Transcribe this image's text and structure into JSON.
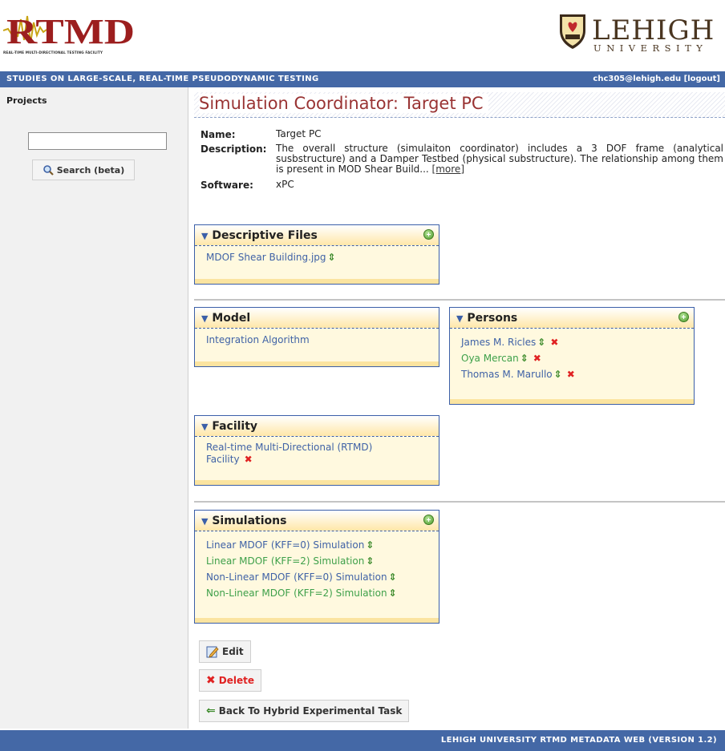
{
  "header": {
    "logo_text": "RTMD",
    "logo_subtitle": "REAL-TIME MULTI-DIRECTIONAL TESTING FACILITY",
    "university_name": "LEHIGH",
    "university_sub": "UNIVERSITY",
    "tagline": "STUDIES ON LARGE-SCALE, REAL-TIME PSEUDODYNAMIC TESTING",
    "user_email": "chc305@lehigh.edu",
    "logout_label": "[logout]"
  },
  "sidebar": {
    "title": "Projects",
    "search_value": "",
    "search_button": "Search (beta)"
  },
  "main": {
    "title": "Simulation Coordinator: Target PC",
    "name_label": "Name:",
    "name_value": "Target PC",
    "description_label": "Description:",
    "description_value": "The overall structure (simulaiton coordinator) includes a 3 DOF frame (analytical susbstructure) and a Damper Testbed (physical substructure). The relationship among them is present in MOD Shear Build...",
    "more_label": "[more]",
    "software_label": "Software:",
    "software_value": "xPC"
  },
  "panels": {
    "descriptive_files": {
      "title": "Descriptive Files",
      "items": [
        "MDOF Shear Building.jpg"
      ]
    },
    "model": {
      "title": "Model",
      "items": [
        "Integration Algorithm"
      ]
    },
    "persons": {
      "title": "Persons",
      "items": [
        "James M. Ricles",
        "Oya Mercan",
        "Thomas M. Marullo"
      ]
    },
    "facility": {
      "title": "Facility",
      "items": [
        "Real-time Multi-Directional (RTMD) Facility"
      ]
    },
    "simulations": {
      "title": "Simulations",
      "items": [
        "Linear MDOF (KFF=0) Simulation",
        "Linear MDOF (KFF=2) Simulation",
        "Non-Linear MDOF (KFF=0) Simulation",
        "Non-Linear MDOF (KFF=2) Simulation"
      ]
    }
  },
  "buttons": {
    "edit": "Edit",
    "delete": "Delete",
    "back": "Back To Hybrid Experimental Task"
  },
  "footer": {
    "text": "LEHIGH UNIVERSITY RTMD METADATA WEB (VERSION 1.2)"
  },
  "colors": {
    "bar_blue": "#4468a6",
    "title_red": "#993333",
    "link_blue": "#3f62a6",
    "link_green": "#3ea04a",
    "panel_yellow": "#fff9df"
  },
  "icons": {
    "search": "magnifier-icon",
    "add": "add-circle-icon",
    "move": "up-down-arrow-icon",
    "delete": "red-x-icon",
    "edit": "pencil-page-icon",
    "back": "left-arrow-icon"
  }
}
